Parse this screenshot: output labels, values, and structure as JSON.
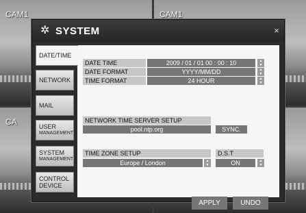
{
  "cameras": [
    {
      "label": "CAM1"
    },
    {
      "label": "CAM1"
    },
    {
      "label": "CA"
    },
    {
      "label": ""
    }
  ],
  "dialog": {
    "title": "SYSTEM",
    "close_label": "×",
    "icon": "gear-icon"
  },
  "menu": [
    {
      "l1": "DATE/TIME",
      "l2": ""
    },
    {
      "l1": "NETWORK",
      "l2": ""
    },
    {
      "l1": "MAIL",
      "l2": ""
    },
    {
      "l1": "USER",
      "l2": "MANAGEMENT"
    },
    {
      "l1": "SYSTEM",
      "l2": "MANAGEMENT"
    },
    {
      "l1": "CONTROL",
      "l2": "DEVICE"
    }
  ],
  "fields": {
    "date_time": {
      "label": "DATE TIME",
      "value": "2009 / 01 / 01   00 : 00 : 10"
    },
    "date_format": {
      "label": "DATE FORMAT",
      "value": "YYYY/MM/DD"
    },
    "time_format": {
      "label": "TIME FORMAT",
      "value": "24 HOUR"
    },
    "ntp": {
      "label": "NETWORK TIME SERVER SETUP",
      "value": "pool.ntp.org",
      "sync_label": "SYNC."
    },
    "timezone": {
      "label": "TIME ZONE SETUP",
      "value": "Europe / London"
    },
    "dst": {
      "label": "D.S.T",
      "value": "ON"
    }
  },
  "buttons": {
    "apply": "APPLY",
    "undo": "UNDO"
  },
  "spinner": {
    "up": "▲",
    "down": "▼"
  }
}
